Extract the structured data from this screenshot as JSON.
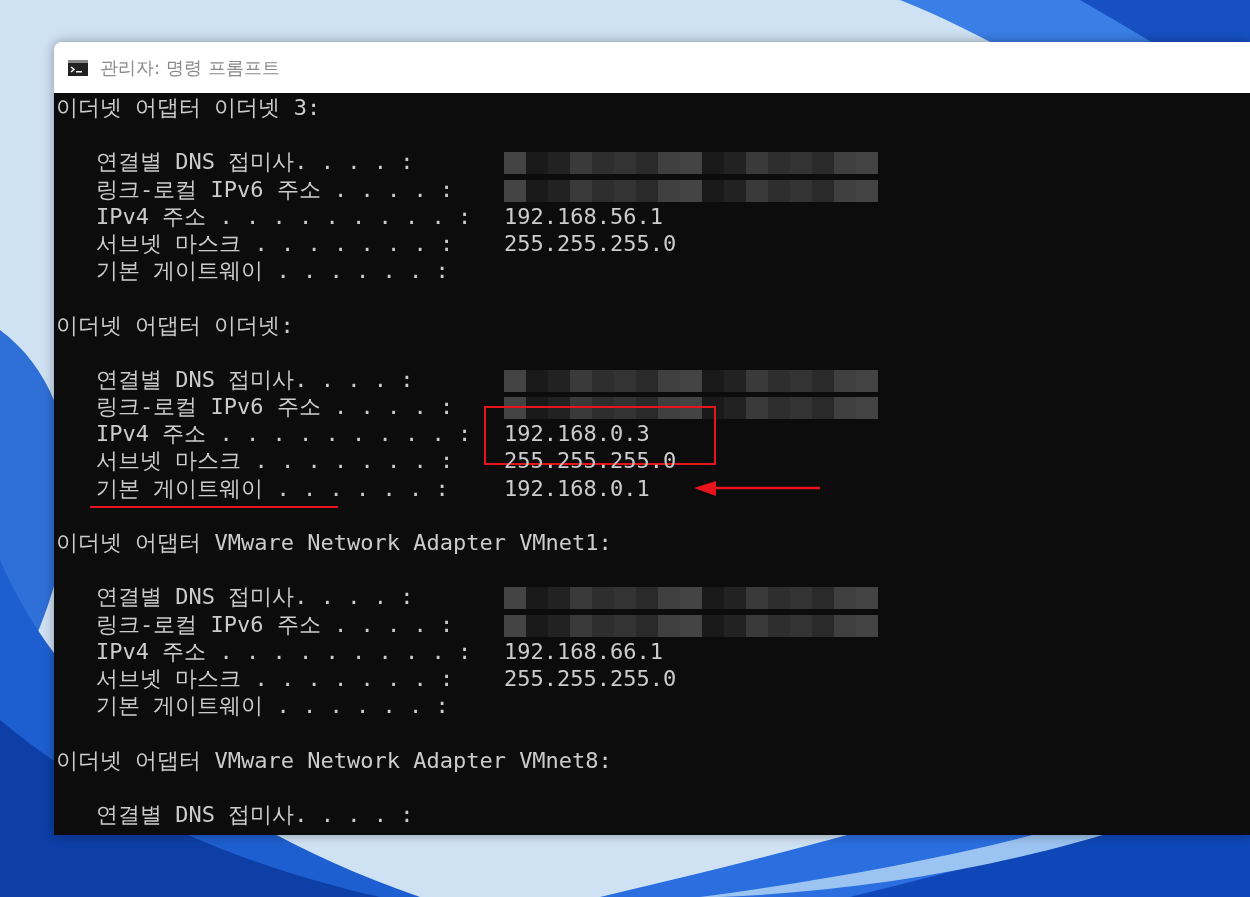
{
  "window": {
    "title": "관리자: 명령 프롬프트"
  },
  "console": {
    "sections": [
      {
        "header": "이더넷 어댑터 이더넷 3:",
        "rows": [
          {
            "label": "연결별 DNS 접미사. . . . :",
            "value_redacted": true
          },
          {
            "label": "링크-로컬 IPv6 주소 . . . . :",
            "value_redacted": true
          },
          {
            "label": "IPv4 주소 . . . . . . . . . :",
            "value": "192.168.56.1"
          },
          {
            "label": "서브넷 마스크 . . . . . . . :",
            "value": "255.255.255.0"
          },
          {
            "label": "기본 게이트웨이 . . . . . . :"
          }
        ]
      },
      {
        "header": "이더넷 어댑터 이더넷:",
        "rows": [
          {
            "label": "연결별 DNS 접미사. . . . :",
            "value_redacted": true
          },
          {
            "label": "링크-로컬 IPv6 주소 . . . . :",
            "value_redacted": true
          },
          {
            "label": "IPv4 주소 . . . . . . . . . :",
            "value": "192.168.0.3",
            "boxed": true
          },
          {
            "label": "서브넷 마스크 . . . . . . . :",
            "value": "255.255.255.0"
          },
          {
            "label": "기본 게이트웨이 . . . . . . :",
            "value": "192.168.0.1",
            "underlined": true,
            "arrowed": true
          }
        ]
      },
      {
        "header": "이더넷 어댑터 VMware Network Adapter VMnet1:",
        "rows": [
          {
            "label": "연결별 DNS 접미사. . . . :",
            "value_redacted": true
          },
          {
            "label": "링크-로컬 IPv6 주소 . . . . :",
            "value_redacted": true
          },
          {
            "label": "IPv4 주소 . . . . . . . . . :",
            "value": "192.168.66.1"
          },
          {
            "label": "서브넷 마스크 . . . . . . . :",
            "value": "255.255.255.0"
          },
          {
            "label": "기본 게이트웨이 . . . . . . :"
          }
        ]
      },
      {
        "header": "이더넷 어댑터 VMware Network Adapter VMnet8:",
        "rows": [
          {
            "label": "연결별 DNS 접미사. . . . :"
          }
        ]
      }
    ]
  }
}
